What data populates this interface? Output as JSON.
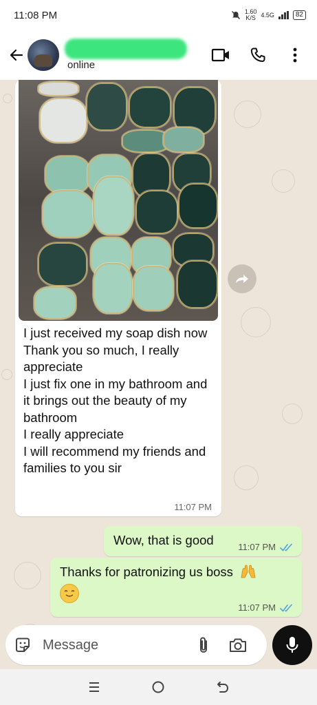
{
  "status_bar": {
    "time": "11:08 PM",
    "speed_value": "1.60",
    "speed_unit": "K/S",
    "network": "4.5G",
    "battery": "82"
  },
  "header": {
    "presence": "online"
  },
  "messages": {
    "incoming": {
      "text": "I just received my soap dish now\nThank you so much, I really appreciate\nI just fix one in my bathroom and it brings out the beauty of my bathroom\nI really appreciate\nI will recommend my friends and families to you sir",
      "time": "11:07 PM"
    },
    "outgoing": [
      {
        "text": "Wow, that is good",
        "time": "11:07 PM"
      },
      {
        "text": "Thanks for patronizing us boss",
        "time": "11:07 PM"
      }
    ]
  },
  "composer": {
    "placeholder": "Message"
  },
  "colors": {
    "outgoing_bubble": "#dcf8c6",
    "read_ticks": "#4fa3e0",
    "chat_background": "#eee5da"
  }
}
